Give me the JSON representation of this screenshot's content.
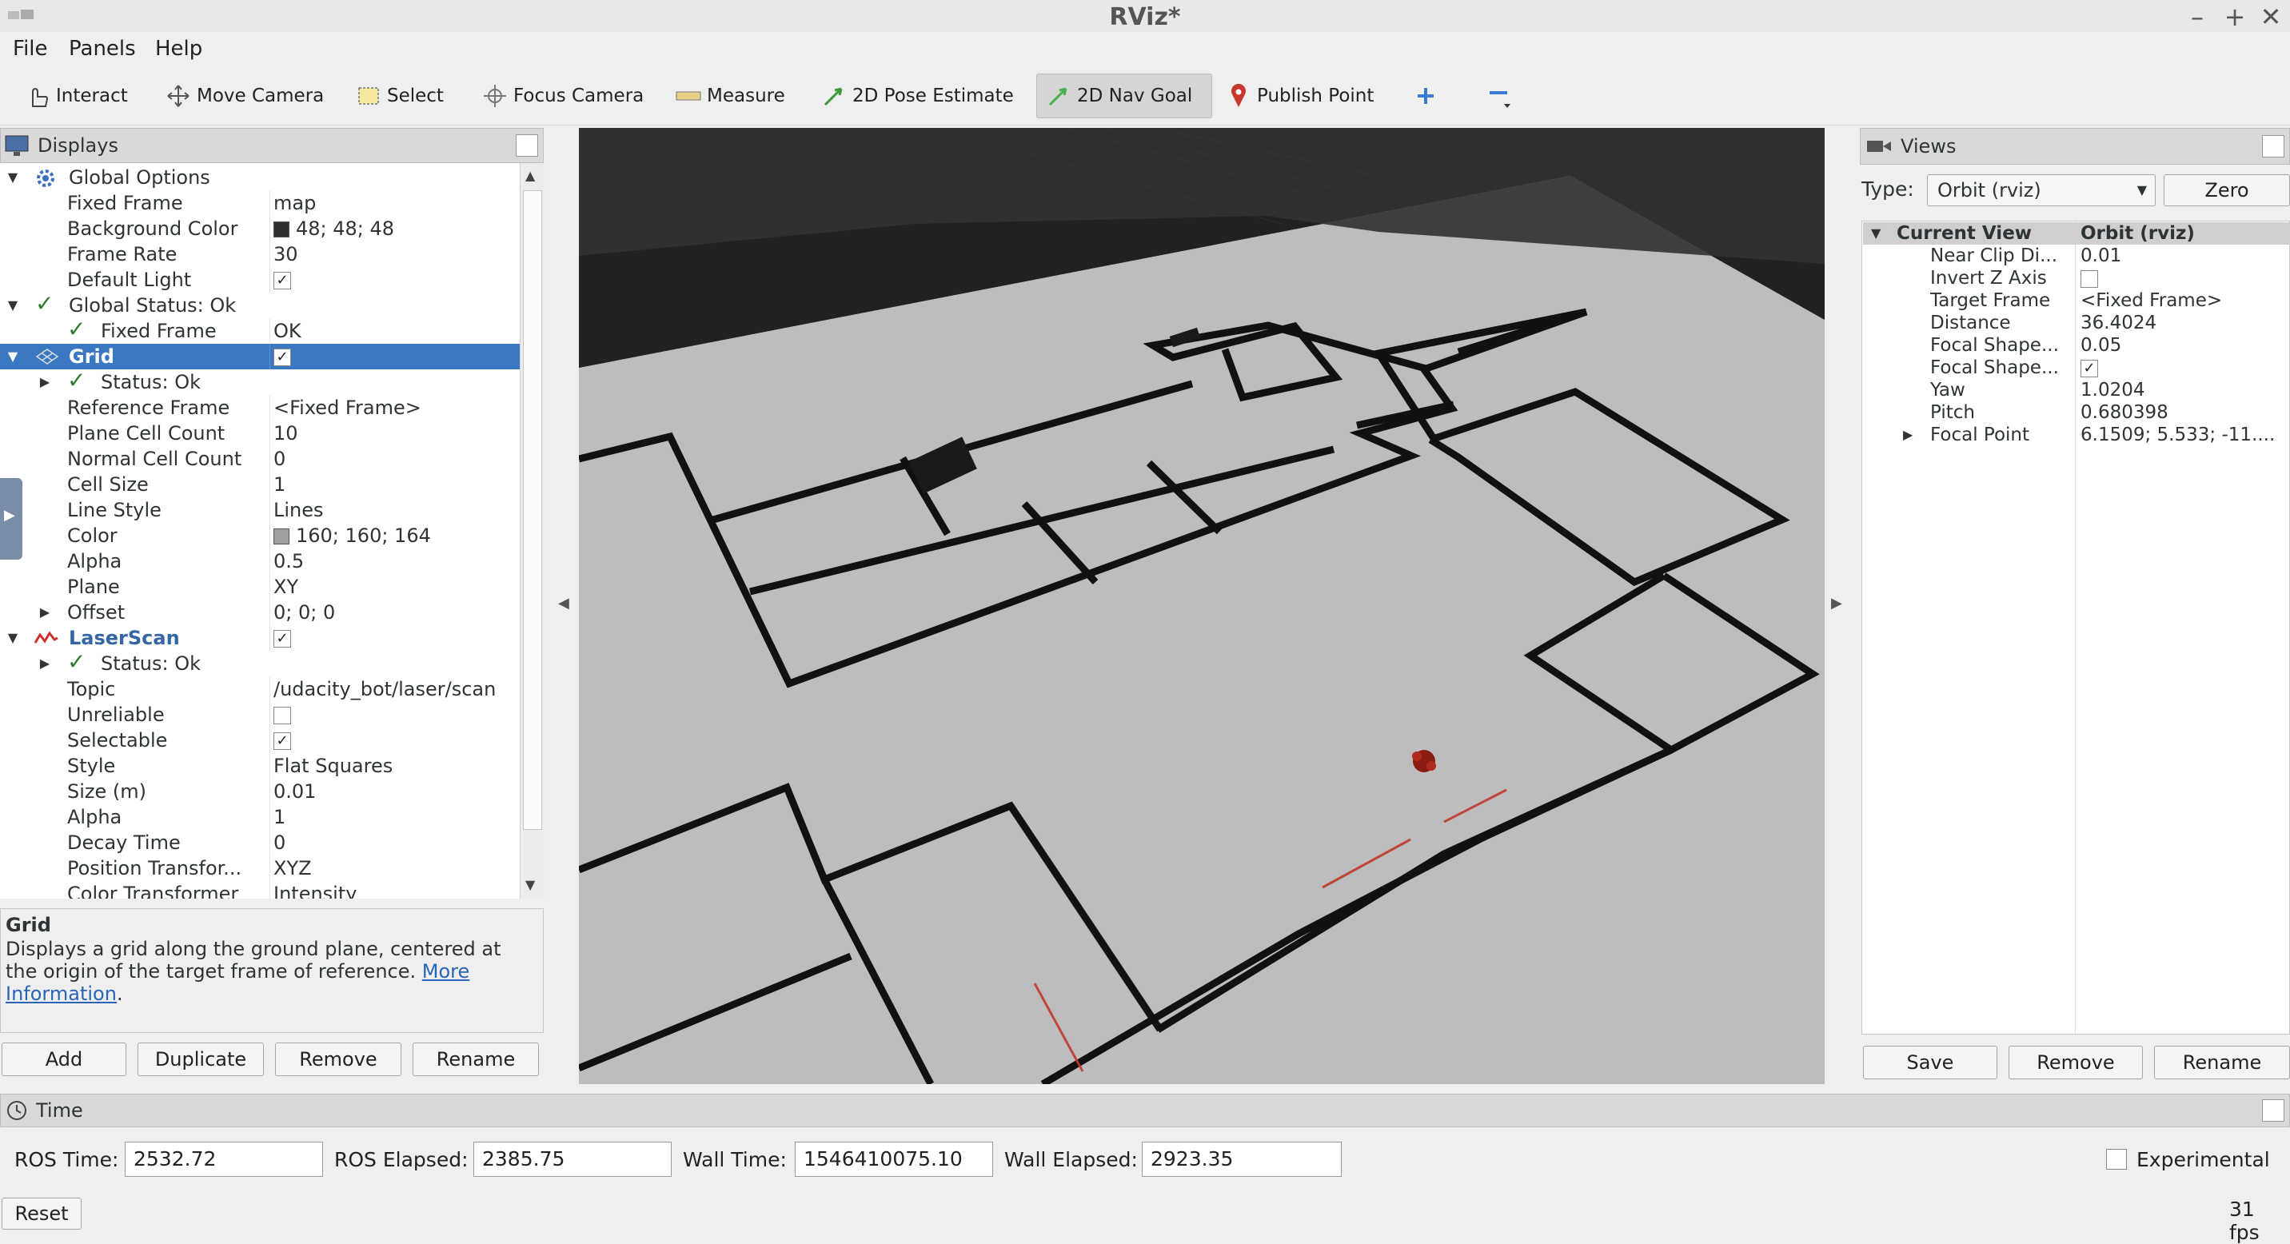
{
  "window": {
    "title": "RViz*"
  },
  "menu": [
    "File",
    "Panels",
    "Help"
  ],
  "toolbar": {
    "interact": "Interact",
    "move_camera": "Move Camera",
    "select": "Select",
    "focus_camera": "Focus Camera",
    "measure": "Measure",
    "pose_estimate": "2D Pose Estimate",
    "nav_goal": "2D Nav Goal",
    "publish_point": "Publish Point"
  },
  "displays": {
    "title": "Displays",
    "rows": [
      {
        "label": "Global Options",
        "value": ""
      },
      {
        "label": "Fixed Frame",
        "value": "map"
      },
      {
        "label": "Background Color",
        "value": "48; 48; 48"
      },
      {
        "label": "Frame Rate",
        "value": "30"
      },
      {
        "label": "Default Light",
        "value": ""
      },
      {
        "label": "Global Status: Ok",
        "value": ""
      },
      {
        "label": "Fixed Frame",
        "value": "OK"
      },
      {
        "label": "Grid",
        "value": ""
      },
      {
        "label": "Status: Ok",
        "value": ""
      },
      {
        "label": "Reference Frame",
        "value": "<Fixed Frame>"
      },
      {
        "label": "Plane Cell Count",
        "value": "10"
      },
      {
        "label": "Normal Cell Count",
        "value": "0"
      },
      {
        "label": "Cell Size",
        "value": "1"
      },
      {
        "label": "Line Style",
        "value": "Lines"
      },
      {
        "label": "Color",
        "value": "160; 160; 164"
      },
      {
        "label": "Alpha",
        "value": "0.5"
      },
      {
        "label": "Plane",
        "value": "XY"
      },
      {
        "label": "Offset",
        "value": "0; 0; 0"
      },
      {
        "label": "LaserScan",
        "value": ""
      },
      {
        "label": "Status: Ok",
        "value": ""
      },
      {
        "label": "Topic",
        "value": "/udacity_bot/laser/scan"
      },
      {
        "label": "Unreliable",
        "value": ""
      },
      {
        "label": "Selectable",
        "value": ""
      },
      {
        "label": "Style",
        "value": "Flat Squares"
      },
      {
        "label": "Size (m)",
        "value": "0.01"
      },
      {
        "label": "Alpha",
        "value": "1"
      },
      {
        "label": "Decay Time",
        "value": "0"
      },
      {
        "label": "Position Transfor...",
        "value": "XYZ"
      },
      {
        "label": "Color Transformer",
        "value": "Intensity"
      }
    ],
    "colors": {
      "background_swatch": "#303030",
      "grid_swatch": "#a0a0a4",
      "selection": "#3a79c2"
    }
  },
  "description": {
    "title": "Grid",
    "text": "Displays a grid along the ground plane, centered at the origin of the target frame of reference.",
    "link1": "More",
    "link2": "Information",
    "after": "."
  },
  "display_buttons": {
    "add": "Add",
    "duplicate": "Duplicate",
    "remove": "Remove",
    "rename": "Rename"
  },
  "views": {
    "title": "Views",
    "type_label": "Type:",
    "type_value": "Orbit (rviz)",
    "zero": "Zero",
    "rows": [
      {
        "label": "Current View",
        "value": "Orbit (rviz)"
      },
      {
        "label": "Near Clip Di...",
        "value": "0.01"
      },
      {
        "label": "Invert Z Axis",
        "value": ""
      },
      {
        "label": "Target Frame",
        "value": "<Fixed Frame>"
      },
      {
        "label": "Distance",
        "value": "36.4024"
      },
      {
        "label": "Focal Shape...",
        "value": "0.05"
      },
      {
        "label": "Focal Shape...",
        "value": ""
      },
      {
        "label": "Yaw",
        "value": "1.0204"
      },
      {
        "label": "Pitch",
        "value": "0.680398"
      },
      {
        "label": "Focal Point",
        "value": "6.1509; 5.533; -11...."
      }
    ],
    "save": "Save",
    "remove": "Remove",
    "rename": "Rename"
  },
  "time": {
    "title": "Time",
    "ros_time_label": "ROS Time:",
    "ros_time": "2532.72",
    "ros_elapsed_label": "ROS Elapsed:",
    "ros_elapsed": "2385.75",
    "wall_time_label": "Wall Time:",
    "wall_time": "1546410075.10",
    "wall_elapsed_label": "Wall Elapsed:",
    "wall_elapsed": "2923.35",
    "experimental": "Experimental",
    "reset": "Reset",
    "fps": "31 fps"
  }
}
